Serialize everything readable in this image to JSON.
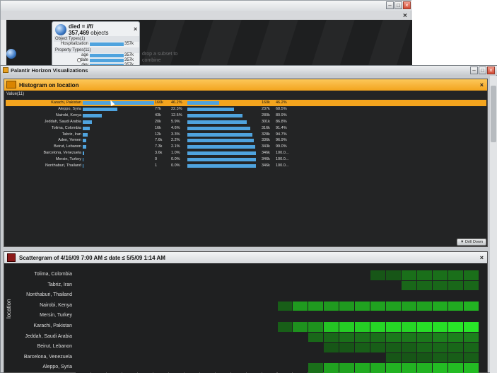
{
  "background_window": {
    "card": {
      "title": "died = //f/",
      "count_value": "357,469",
      "count_suffix": "objects",
      "object_types_label": "Object Types(1)",
      "property_types_label": "Property Types(11)",
      "object_rows": [
        {
          "label": "Hospitalization",
          "value": "357k",
          "fraction": 1.0
        }
      ],
      "property_rows": [
        {
          "label": "age",
          "value": "357k",
          "fraction": 1.0
        },
        {
          "label": "date",
          "value": "357k",
          "fraction": 1.0
        },
        {
          "label": "dev",
          "value": "357k",
          "fraction": 1.0
        }
      ]
    },
    "drop_hint": "drop a subset to combine"
  },
  "main_window": {
    "title": "Palantir Horizon Visualizations"
  },
  "histogram": {
    "title": "Histogram on location",
    "values_label": "Value(11)",
    "drill_down_label": "Drill Down",
    "rows": [
      {
        "location": "Karachi, Pakistan",
        "count": "160k",
        "pct": "46.2%",
        "share": 0.462,
        "cumulative": "160k",
        "cum_pct": "46.2%",
        "cum_share": 0.462,
        "selected": true
      },
      {
        "location": "Aleppo, Syria",
        "count": "77k",
        "pct": "22.3%",
        "share": 0.223,
        "cumulative": "237k",
        "cum_pct": "68.5%",
        "cum_share": 0.685
      },
      {
        "location": "Nairobi, Kenya",
        "count": "43k",
        "pct": "12.5%",
        "share": 0.125,
        "cumulative": "280k",
        "cum_pct": "80.9%",
        "cum_share": 0.809
      },
      {
        "location": "Jeddah, Saudi Arabia",
        "count": "20k",
        "pct": "5.9%",
        "share": 0.059,
        "cumulative": "301k",
        "cum_pct": "86.8%",
        "cum_share": 0.868
      },
      {
        "location": "Tolima, Colombia",
        "count": "16k",
        "pct": "4.6%",
        "share": 0.046,
        "cumulative": "316k",
        "cum_pct": "91.4%",
        "cum_share": 0.914
      },
      {
        "location": "Tabriz, Iran",
        "count": "12k",
        "pct": "3.3%",
        "share": 0.033,
        "cumulative": "328k",
        "cum_pct": "94.7%",
        "cum_share": 0.947
      },
      {
        "location": "Aden, Yemen",
        "count": "7.6k",
        "pct": "2.2%",
        "share": 0.022,
        "cumulative": "336k",
        "cum_pct": "96.9%",
        "cum_share": 0.969
      },
      {
        "location": "Beirut, Lebanon",
        "count": "7.3k",
        "pct": "2.1%",
        "share": 0.021,
        "cumulative": "343k",
        "cum_pct": "99.0%",
        "cum_share": 0.99
      },
      {
        "location": "Barcelona, Venezuela",
        "count": "3.6k",
        "pct": "1.0%",
        "share": 0.01,
        "cumulative": "346k",
        "cum_pct": "100.0...",
        "cum_share": 1.0
      },
      {
        "location": "Mersin, Turkey",
        "count": "0",
        "pct": "0.0%",
        "share": 0.0,
        "cumulative": "346k",
        "cum_pct": "100.0...",
        "cum_share": 1.0
      },
      {
        "location": "Nonthaburi, Thailand",
        "count": "1",
        "pct": "0.0%",
        "share": 0.0,
        "cumulative": "346k",
        "cum_pct": "100.0...",
        "cum_share": 1.0
      }
    ]
  },
  "scattergram": {
    "title": "Scattergram of 4/16/09 7:00 AM ≤ date ≤ 5/5/09 1:14 AM",
    "ylabel": "location",
    "rows": [
      {
        "location": "Tolima, Colombia",
        "cells": [
          0,
          0,
          0,
          0,
          0,
          0,
          0,
          0,
          0,
          0,
          0,
          0,
          0,
          0,
          0,
          0,
          0,
          0,
          0,
          0.15,
          0.15,
          0.3,
          0.3,
          0.3,
          0.3,
          0.3
        ]
      },
      {
        "location": "Tabriz, Iran",
        "cells": [
          0,
          0,
          0,
          0,
          0,
          0,
          0,
          0,
          0,
          0,
          0,
          0,
          0,
          0,
          0,
          0,
          0,
          0,
          0,
          0,
          0,
          0.25,
          0.25,
          0.25,
          0.25,
          0.25
        ]
      },
      {
        "location": "Nonthaburi, Thailand",
        "cells": [
          0,
          0,
          0,
          0,
          0,
          0,
          0,
          0,
          0,
          0,
          0,
          0,
          0,
          0,
          0,
          0,
          0,
          0,
          0,
          0,
          0,
          0,
          0,
          0,
          0,
          0
        ]
      },
      {
        "location": "Nairobi, Kenya",
        "cells": [
          0,
          0,
          0,
          0,
          0,
          0,
          0,
          0,
          0,
          0,
          0,
          0,
          0,
          0.2,
          0.55,
          0.55,
          0.55,
          0.55,
          0.6,
          0.6,
          0.6,
          0.6,
          0.6,
          0.65,
          0.65,
          0.7
        ]
      },
      {
        "location": "Mersin, Turkey",
        "cells": [
          0,
          0,
          0,
          0,
          0,
          0,
          0,
          0,
          0,
          0,
          0,
          0,
          0,
          0,
          0,
          0,
          0,
          0,
          0,
          0,
          0,
          0,
          0,
          0,
          0,
          0
        ]
      },
      {
        "location": "Karachi, Pakistan",
        "cells": [
          0,
          0,
          0,
          0,
          0,
          0,
          0,
          0,
          0,
          0,
          0,
          0,
          0,
          0.2,
          0.5,
          0.5,
          0.8,
          0.85,
          0.85,
          0.9,
          0.9,
          0.9,
          0.95,
          0.95,
          1.0,
          1.0
        ]
      },
      {
        "location": "Jeddah, Saudi Arabia",
        "cells": [
          0,
          0,
          0,
          0,
          0,
          0,
          0,
          0,
          0,
          0,
          0,
          0,
          0,
          0,
          0,
          0.25,
          0.25,
          0.3,
          0.3,
          0.3,
          0.35,
          0.35,
          0.35,
          0.4,
          0.4,
          0.4
        ]
      },
      {
        "location": "Beirut, Lebanon",
        "cells": [
          0,
          0,
          0,
          0,
          0,
          0,
          0,
          0,
          0,
          0,
          0,
          0,
          0,
          0,
          0,
          0,
          0.15,
          0.15,
          0.2,
          0.2,
          0.2,
          0.2,
          0.25,
          0.25,
          0.25,
          0.25
        ]
      },
      {
        "location": "Barcelona, Venezuela",
        "cells": [
          0,
          0,
          0,
          0,
          0,
          0,
          0,
          0,
          0,
          0,
          0,
          0,
          0,
          0,
          0,
          0,
          0,
          0,
          0,
          0,
          0.15,
          0.15,
          0.15,
          0.2,
          0.2,
          0.2
        ]
      },
      {
        "location": "Aleppo, Syria",
        "cells": [
          0,
          0,
          0,
          0,
          0,
          0,
          0,
          0,
          0,
          0,
          0,
          0,
          0,
          0,
          0,
          0.3,
          0.6,
          0.6,
          0.65,
          0.65,
          0.7,
          0.7,
          0.7,
          0.75,
          0.75,
          0.75
        ]
      }
    ]
  },
  "colors": {
    "accent_orange": "#f3a41e",
    "bar_blue": "#4fa3de",
    "heat_green": "#22d022"
  }
}
